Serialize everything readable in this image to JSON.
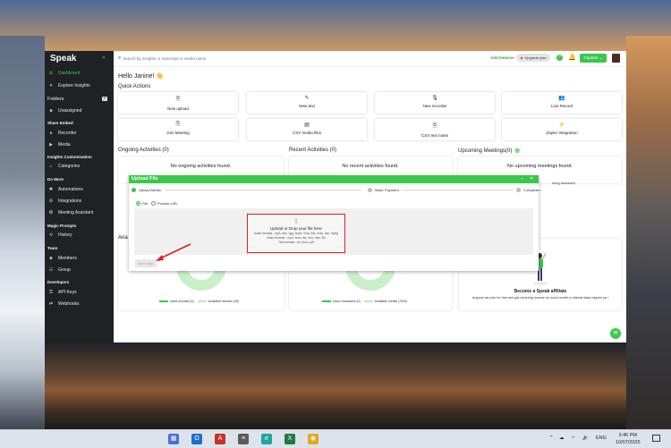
{
  "app": {
    "logo": "Speak",
    "collapse_icon": "double-chevron-left-icon"
  },
  "sidebar": {
    "items": [
      {
        "label": "Dashboard",
        "icon": "⊞"
      },
      {
        "label": "Explore Insights",
        "icon": "✦"
      },
      {
        "label": "Unassigned",
        "icon": "■"
      },
      {
        "label": "Recorder",
        "icon": "●"
      },
      {
        "label": "Media",
        "icon": "▶"
      },
      {
        "label": "Categories",
        "icon": "⌂"
      },
      {
        "label": "Automations",
        "icon": "✱"
      },
      {
        "label": "Integrations",
        "icon": "⚙"
      },
      {
        "label": "Meeting Assistant",
        "icon": "✪"
      },
      {
        "label": "History",
        "icon": "⟲"
      },
      {
        "label": "Members",
        "icon": "☻"
      },
      {
        "label": "Group",
        "icon": "☷"
      },
      {
        "label": "API Keys",
        "icon": "⚿"
      },
      {
        "label": "Webhooks",
        "icon": "⇄"
      }
    ],
    "headings": {
      "folders": "Folders",
      "share_embed": "Share Embed",
      "insights": "Insights Customisation",
      "do_more": "Do More",
      "magic_prompts": "Magic Prompts",
      "team": "Team",
      "developers": "Developers"
    }
  },
  "topbar": {
    "search_placeholder": "Search by insights or transcript or media name",
    "add_balance": "Add balance",
    "upgrade": "Upgrade plan",
    "capture": "Capture ⌄"
  },
  "dashboard": {
    "greeting": "Hello Janine! 👋",
    "quick_actions_title": "Quick Actions",
    "quick_actions": [
      {
        "label": "New upload",
        "icon": "🗎"
      },
      {
        "label": "New text",
        "icon": "✎"
      },
      {
        "label": "New recorder",
        "icon": "🎙"
      },
      {
        "label": "Live Record",
        "icon": "👥"
      },
      {
        "label": "Join Meeting",
        "icon": "⎘"
      },
      {
        "label": "CSV media files",
        "icon": "▤"
      },
      {
        "label": "CSV text notes",
        "icon": "🗎"
      },
      {
        "label": "Zapier Integration",
        "icon": "⚡"
      }
    ],
    "ongoing_title": "Ongoing Activities (0)",
    "ongoing_empty": "No ongoing activities found.",
    "recent_title": "Recent Activities (0)",
    "recent_empty": "No recent activities found.",
    "upcoming_title": "Upcoming Meetings(0)",
    "upcoming_empty": "No upcoming meetings found.",
    "meeting_assistant_note": "eting Assistant",
    "analytics_partial": "Ana",
    "legend1_a": "Used minutes (0)",
    "legend1_b": "Available minutes (30)",
    "legend2_a": "Used characters (0)",
    "legend2_b": "Available credits (7000)",
    "affiliate_title": "Become a Speak affiliate",
    "affiliate_desc": "Anyone can join for free and get recurring income for every month a referral stays signed up !"
  },
  "modal": {
    "title": "Upload File",
    "steps": [
      "Upload Media",
      "Make Payment",
      "Completed"
    ],
    "source_options": [
      "File",
      "Provide URL"
    ],
    "drop_title": "Upload or Drop your file here",
    "drop_lines": [
      "Audio formats - mp3, aac, ogg, wave, m4a, flac, m4p, aac, mpeg",
      "Video formats - mp4, wmv, avi, mov, mkv, 3ts",
      "Text formats - txt, docx, pdf"
    ],
    "next": "Next step"
  },
  "taskbar": {
    "language": "ENG",
    "time": "3:46 PM",
    "date": "10/07/2025"
  },
  "colors": {
    "brand": "#39c84a",
    "highlight": "#d92121"
  }
}
